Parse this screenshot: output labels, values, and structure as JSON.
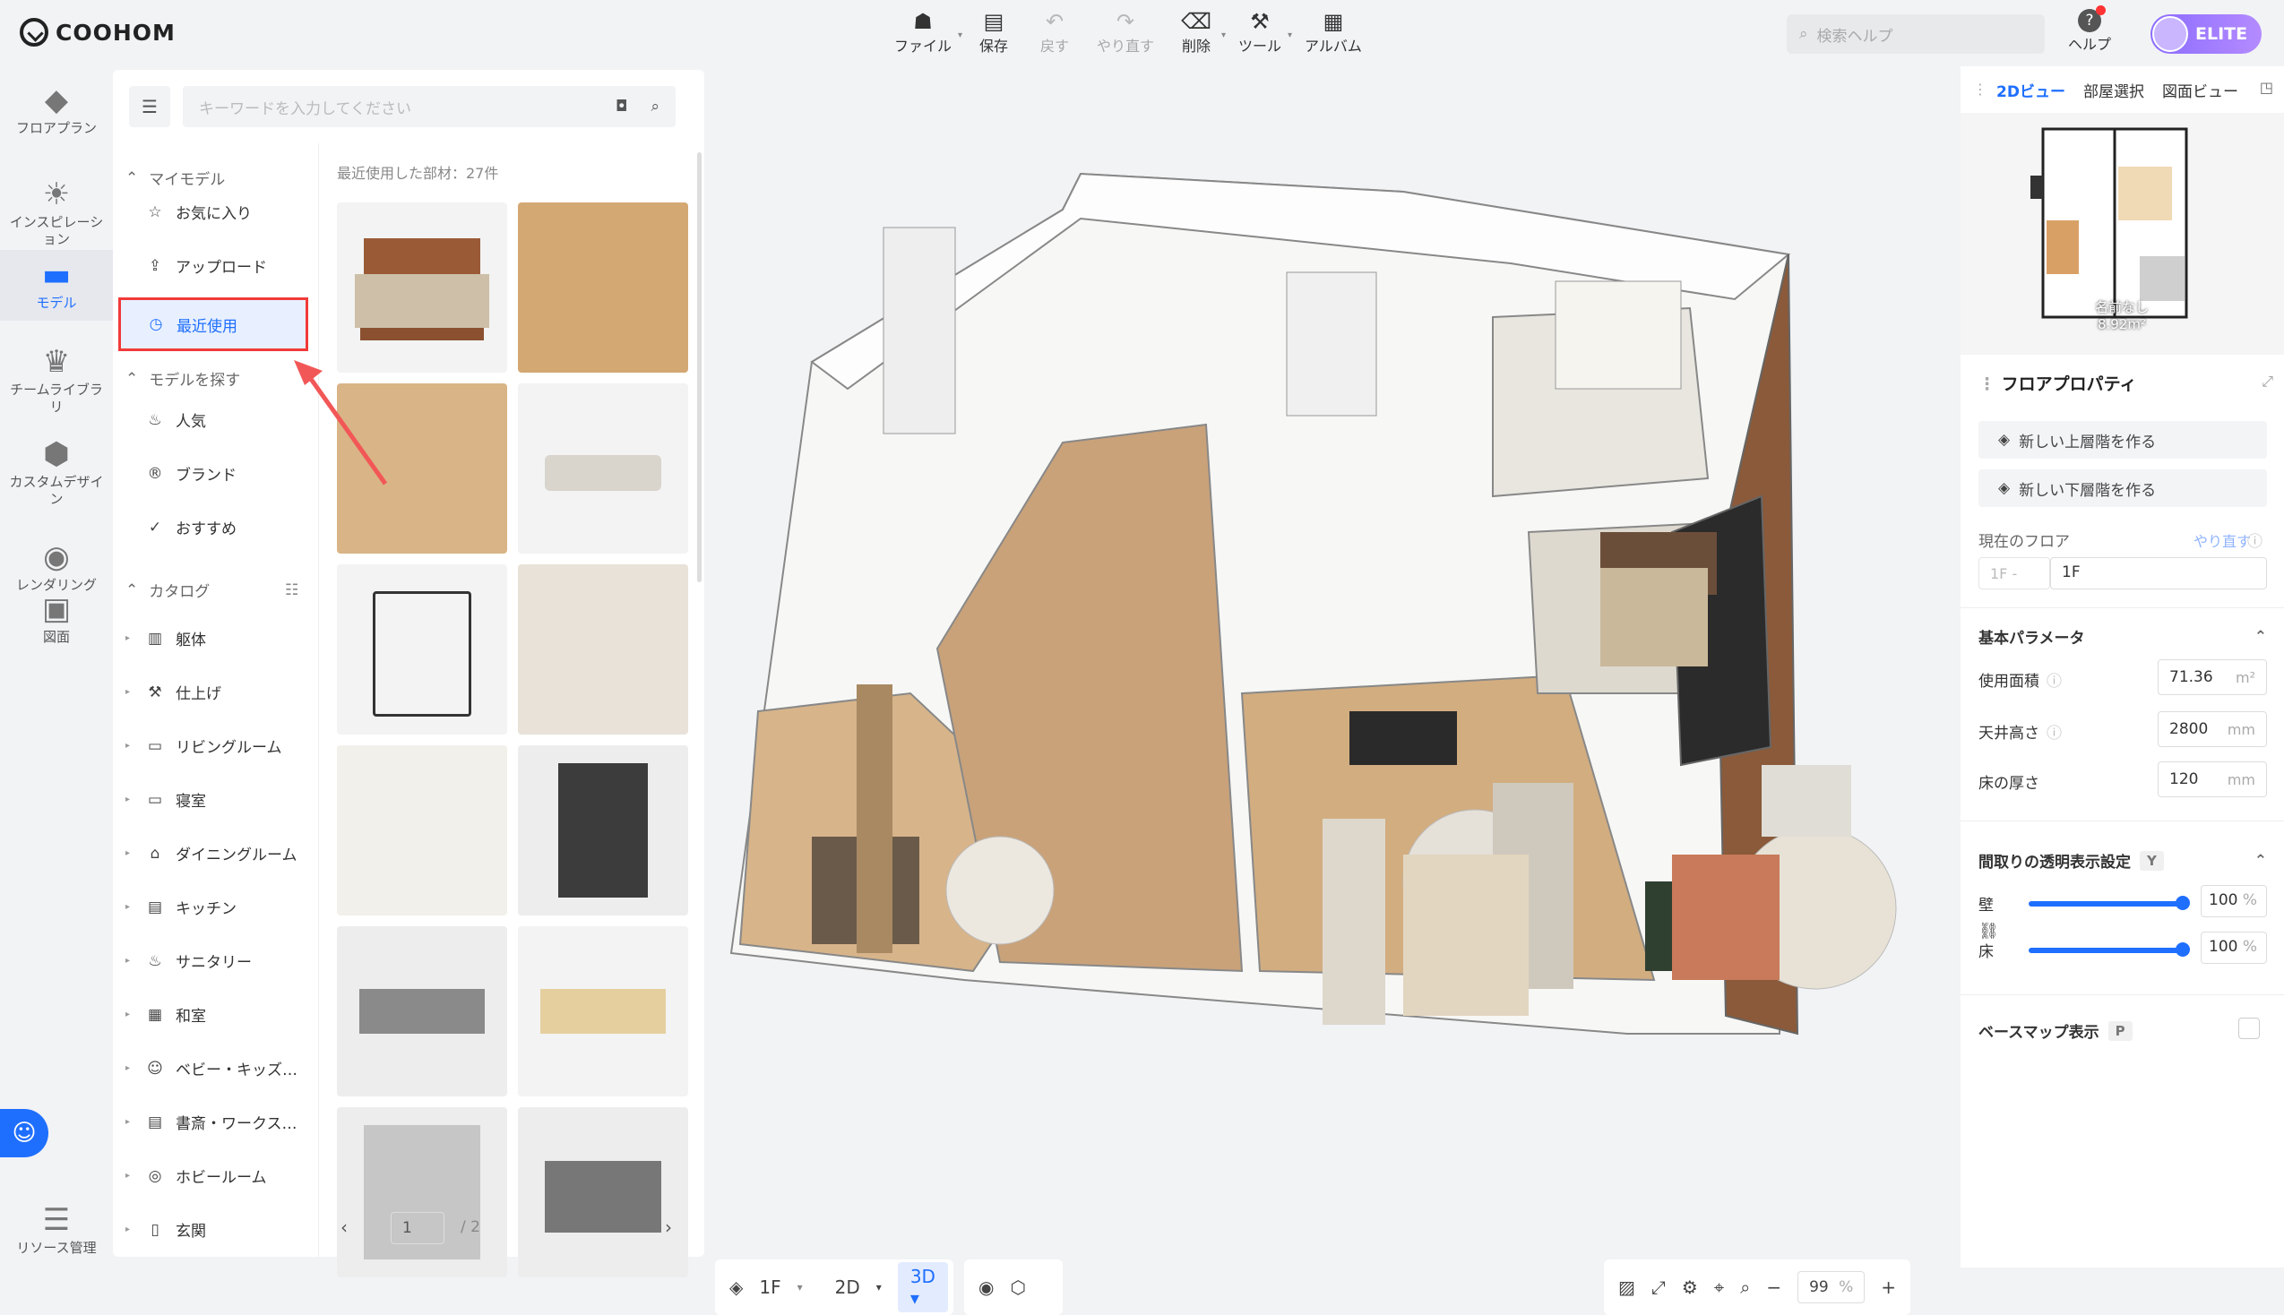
{
  "app": {
    "logo": "COOHOM"
  },
  "toolbar": [
    {
      "label": "ファイル",
      "icon": "☗",
      "dim": false,
      "caret": true
    },
    {
      "label": "保存",
      "icon": "▤",
      "dim": false,
      "caret": false
    },
    {
      "label": "戻す",
      "icon": "↶",
      "dim": true,
      "caret": false
    },
    {
      "label": "やり直す",
      "icon": "↷",
      "dim": true,
      "caret": false
    },
    {
      "label": "削除",
      "icon": "⌫",
      "dim": false,
      "caret": true
    },
    {
      "label": "ツール",
      "icon": "⚒",
      "dim": false,
      "caret": true
    },
    {
      "label": "アルバム",
      "icon": "▦",
      "dim": false,
      "caret": false
    }
  ],
  "header": {
    "search_placeholder": "検索ヘルプ",
    "help": "ヘルプ",
    "plan": "ELITE"
  },
  "leftnav": [
    {
      "label": "フロアプラン",
      "icon": "◆",
      "active": false
    },
    {
      "label": "インスピレーション",
      "icon": "☀",
      "active": false
    },
    {
      "label": "モデル",
      "icon": "▬",
      "active": true
    },
    {
      "label": "チームライブラリ",
      "icon": "♛",
      "active": false
    },
    {
      "label": "カスタムデザイン",
      "icon": "⬢",
      "active": false
    },
    {
      "label": "レンダリング",
      "icon": "◉",
      "active": false
    },
    {
      "label": "図面",
      "icon": "▣",
      "active": false
    },
    {
      "label": "リソース管理",
      "icon": "☰",
      "active": false
    }
  ],
  "library": {
    "search_placeholder": "キーワードを入力してください",
    "my_models": "マイモデル",
    "favorites": "お気に入り",
    "upload": "アップロード",
    "recent": "最近使用",
    "explore": "モデルを探す",
    "popular": "人気",
    "brand": "ブランド",
    "recommended": "おすすめ",
    "catalog": "カタログ",
    "categories": [
      "躯体",
      "仕上げ",
      "リビングルーム",
      "寝室",
      "ダイニングルーム",
      "キッチン",
      "サニタリー",
      "和室",
      "ベビー・キッズ…",
      "書斎・ワークス…",
      "ホビールーム",
      "玄関"
    ],
    "recent_label": "最近使用した部材：27件",
    "page": "1",
    "total": "/ 2"
  },
  "canvas": {
    "floor": "1F",
    "v2d": "2D",
    "v3d": "3D",
    "zoom": "99",
    "zoom_unit": "%"
  },
  "right": {
    "tabs": [
      "2Dビュー",
      "部屋選択",
      "図面ビュー"
    ],
    "minimap_label": "名前なし",
    "minimap_area": "8.92m²",
    "title": "フロアプロパティ",
    "btn_up": "新しい上層階を作る",
    "btn_down": "新しい下層階を作る",
    "current_floor": "現在のフロア",
    "redo": "やり直す",
    "floor_prefix": "1F",
    "floor_name": "1F",
    "basic": "基本パラメータ",
    "area_label": "使用面積",
    "area": "71.36",
    "area_unit": "m²",
    "ceiling_label": "天井高さ",
    "ceiling": "2800",
    "ceiling_unit": "mm",
    "thick_label": "床の厚さ",
    "thick": "120",
    "thick_unit": "mm",
    "trans": "間取りの透明表示設定",
    "trans_key": "Y",
    "wall": "壁",
    "wall_val": "100",
    "floor": "床",
    "floor_val": "100",
    "pct": "%",
    "basemap": "ベースマップ表示",
    "basemap_key": "P"
  }
}
